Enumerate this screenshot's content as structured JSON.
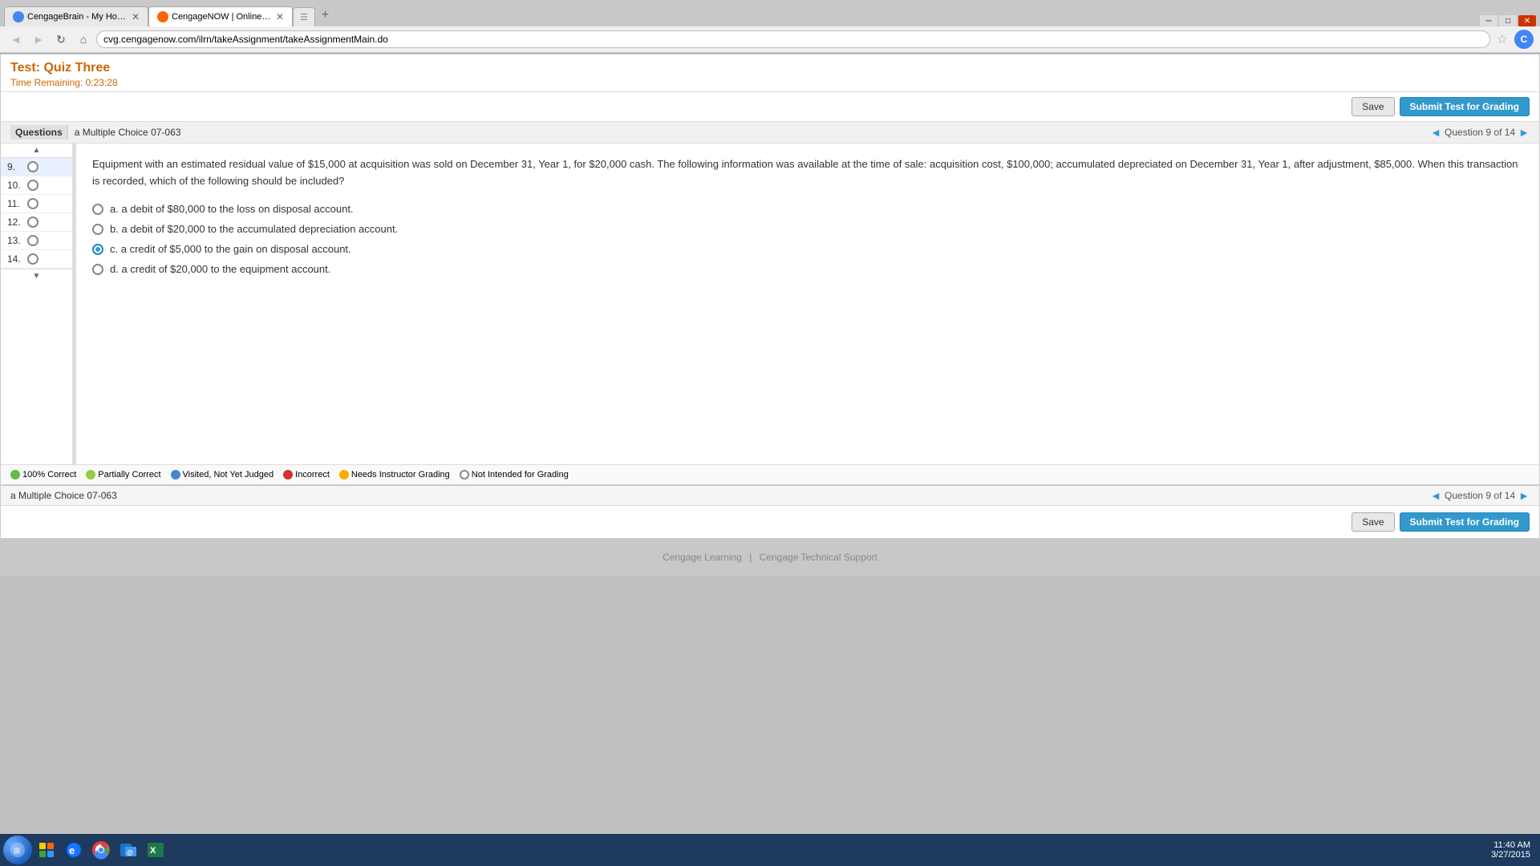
{
  "browser": {
    "tabs": [
      {
        "id": "tab1",
        "label": "CengageBrain - My Hom...",
        "active": false,
        "favicon": "brain"
      },
      {
        "id": "tab2",
        "label": "CengageNOW | Online te...",
        "active": true,
        "favicon": "cengage"
      },
      {
        "id": "tab3",
        "label": "",
        "active": false,
        "favicon": "new"
      }
    ],
    "address": "cvg.cengagenow.com/ilrn/takeAssignment/takeAssignmentMain.do"
  },
  "test": {
    "title": "Test: Quiz Three",
    "time_remaining_label": "Time Remaining:",
    "time_remaining": "0:23:28",
    "save_label": "Save",
    "submit_label": "Submit Test for Grading"
  },
  "question_nav": {
    "prefix": "◄ Question",
    "current": "9",
    "separator": "of",
    "total": "14",
    "suffix": "►"
  },
  "sidebar": {
    "header": "Questions",
    "items": [
      {
        "num": "9.",
        "answered": false,
        "active": true
      },
      {
        "num": "10.",
        "answered": false,
        "active": false
      },
      {
        "num": "11.",
        "answered": false,
        "active": false
      },
      {
        "num": "12.",
        "answered": false,
        "active": false
      },
      {
        "num": "13.",
        "answered": false,
        "active": false
      },
      {
        "num": "14.",
        "answered": false,
        "active": false
      }
    ]
  },
  "question": {
    "section_label": "a Multiple Choice 07-063",
    "text": "Equipment with an estimated residual value of $15,000 at acquisition was sold on December 31, Year 1, for $20,000 cash. The following information was available at the time of sale: acquisition cost, $100,000; accumulated depreciated on December 31, Year 1, after adjustment, $85,000. When this transaction is recorded, which of the following should be included?",
    "choices": [
      {
        "id": "a",
        "text": "a. a debit of $80,000 to the loss on disposal account.",
        "selected": false
      },
      {
        "id": "b",
        "text": "b. a debit of $20,000 to the accumulated depreciation account.",
        "selected": false
      },
      {
        "id": "c",
        "text": "c. a credit of $5,000 to the gain on disposal account.",
        "selected": true
      },
      {
        "id": "d",
        "text": "d. a credit of $20,000 to the equipment account.",
        "selected": false
      }
    ]
  },
  "legend": [
    {
      "type": "correct",
      "label": "100% Correct"
    },
    {
      "type": "partial",
      "label": "Partially Correct"
    },
    {
      "type": "visited",
      "label": "Visited, Not Yet Judged"
    },
    {
      "type": "incorrect",
      "label": "Incorrect"
    },
    {
      "type": "instructor",
      "label": "Needs Instructor Grading"
    },
    {
      "type": "not-intended",
      "label": "Not Intended for Grading"
    }
  ],
  "footer": {
    "cengage_learning": "Cengage Learning",
    "separator": "|",
    "support": "Cengage Technical Support"
  },
  "taskbar": {
    "clock_time": "11:40 AM",
    "clock_date": "3/27/2015"
  }
}
